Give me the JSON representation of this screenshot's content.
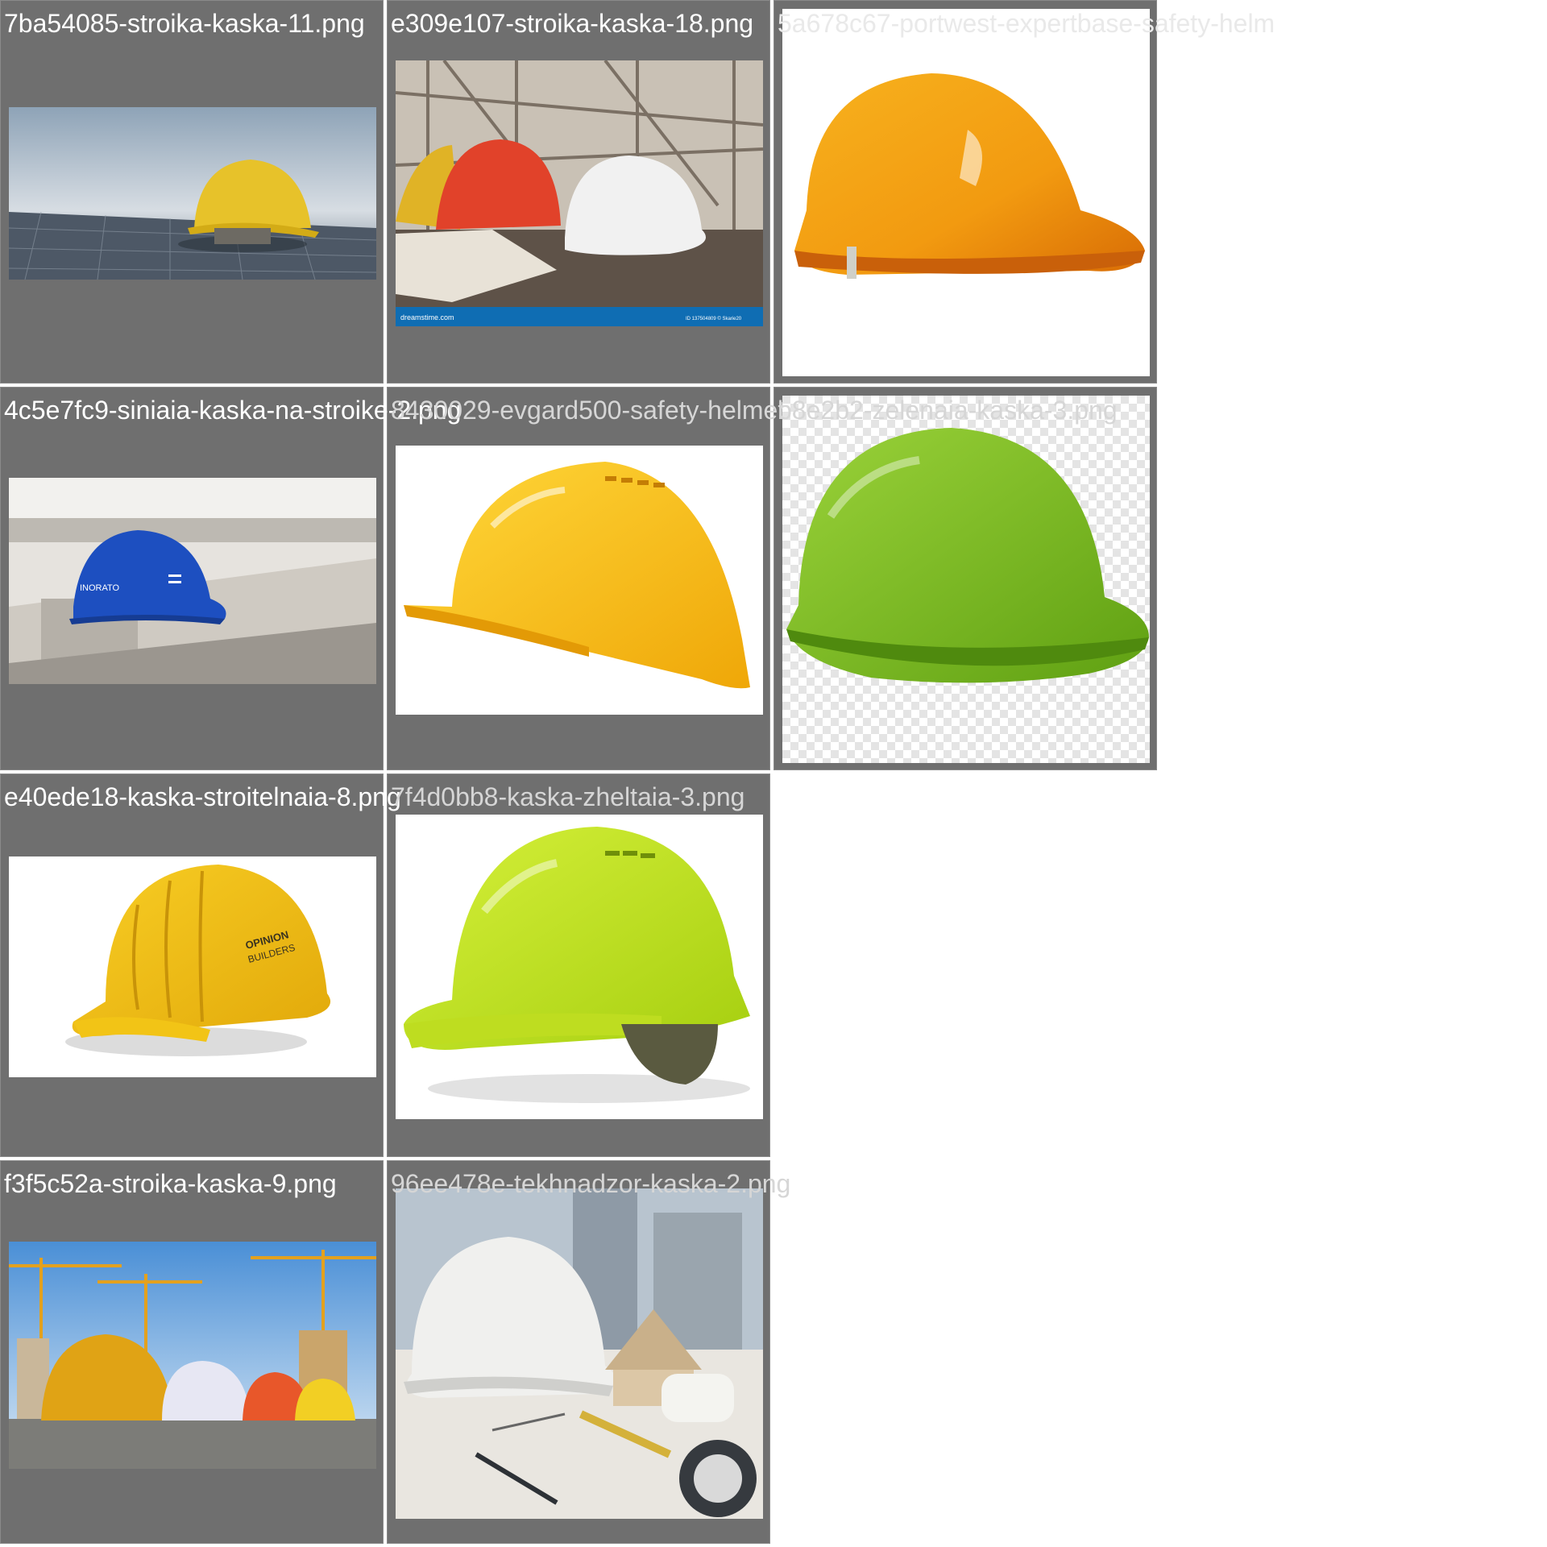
{
  "grid": {
    "tiles": [
      {
        "filename": "7ba54085-stroika-kaska-11.png",
        "icon": "yellow-helmet-solar-panels"
      },
      {
        "filename": "e309e107-stroika-kaska-18.png",
        "icon": "three-helmets-blueprints",
        "watermark": "dreamstime.com",
        "watermark_id": "ID 137504809 © Skarie20"
      },
      {
        "filename": "5a678c67-portwest-expertbase-safety-helm",
        "icon": "orange-helmet"
      },
      {
        "filename": "4c5e7fc9-siniaia-kaska-na-stroike-2.png",
        "icon": "blue-helmet-on-beams",
        "helmet_text": "INORATO"
      },
      {
        "filename": "8430029-evgard500-safety-helmet",
        "icon": "yellow-vented-helmet"
      },
      {
        "filename": "b8e2b2-zelenaia-kaska-3.png",
        "icon": "green-helmet"
      },
      {
        "filename": "e40ede18-kaska-stroitelnaia-8.png",
        "icon": "yellow-branded-helmet",
        "helmet_text_1": "OPINION",
        "helmet_text_2": "BUILDERS"
      },
      {
        "filename": "7f4d0bb8-kaska-zheltaia-3.png",
        "icon": "lime-helmet"
      },
      {
        "filename": "f3f5c52a-stroika-kaska-9.png",
        "icon": "helmets-with-cranes"
      },
      {
        "filename": "96ee478e-tekhnadzor-kaska-2.png",
        "icon": "white-helmet-desk"
      }
    ]
  }
}
